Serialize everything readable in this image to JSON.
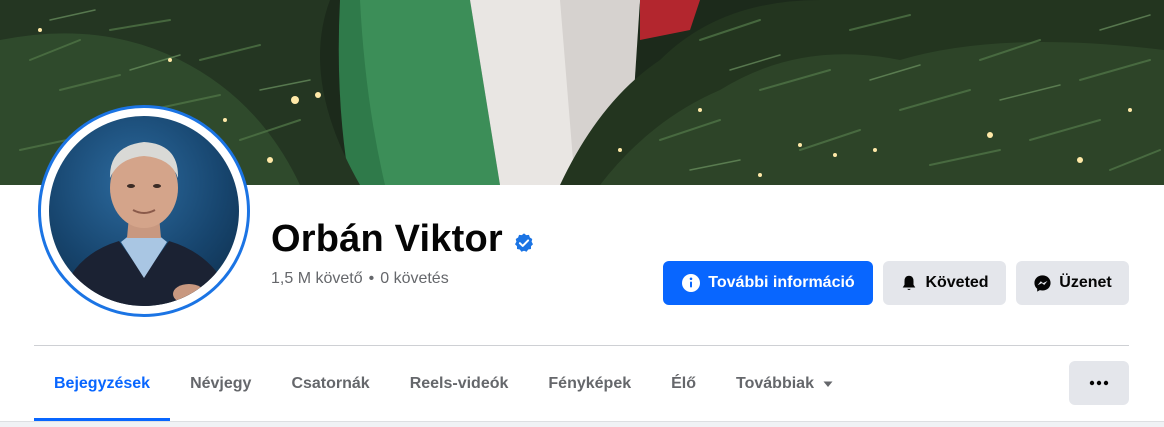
{
  "profile": {
    "name": "Orbán Viktor",
    "verified": true,
    "followers": "1,5 M követő",
    "separator": "•",
    "following": "0 követés"
  },
  "actions": {
    "more_info": "További információ",
    "following_button": "Követed",
    "message_button": "Üzenet"
  },
  "tabs": [
    {
      "label": "Bejegyzések",
      "active": true
    },
    {
      "label": "Névjegy",
      "active": false
    },
    {
      "label": "Csatornák",
      "active": false
    },
    {
      "label": "Reels-videók",
      "active": false
    },
    {
      "label": "Fényképek",
      "active": false
    },
    {
      "label": "Élő",
      "active": false
    },
    {
      "label": "Továbbiak",
      "active": false
    }
  ],
  "colors": {
    "accent": "#0866ff",
    "secondary_button": "#e4e6eb",
    "muted_text": "#65676b",
    "verified_badge": "#1b74e4"
  },
  "icons": {
    "info": "info-circle-icon",
    "bell": "bell-icon",
    "messenger": "messenger-icon",
    "verified": "verified-badge-icon",
    "more": "ellipsis-icon",
    "caret": "caret-down-icon"
  }
}
